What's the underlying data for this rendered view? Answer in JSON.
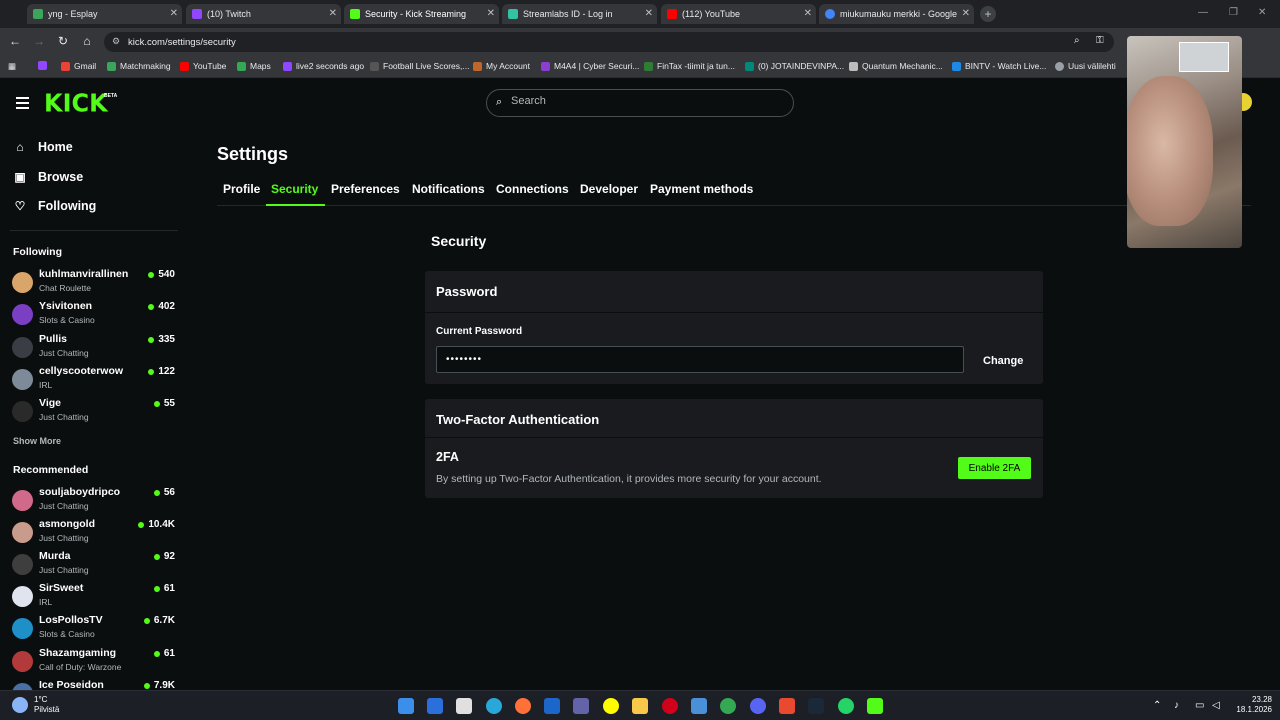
{
  "browser": {
    "tabs": [
      {
        "label": "yng - Esplay",
        "color": "#3ba55c"
      },
      {
        "label": "(10) Twitch",
        "color": "#9146ff"
      },
      {
        "label": "Security - Kick Streaming",
        "color": "#53fc18"
      },
      {
        "label": "Streamlabs ID - Log in",
        "color": "#31c3a2"
      },
      {
        "label": "(112) YouTube",
        "color": "#ff0000"
      },
      {
        "label": "miukumauku merkki - Google",
        "color": "#4285f4"
      }
    ],
    "url": "kick.com/settings/security",
    "bookmarks": [
      {
        "label": "",
        "color": "#9146ff"
      },
      {
        "label": "Gmail",
        "color": "#ea4335"
      },
      {
        "label": "Matchmaking",
        "color": "#3ba55c"
      },
      {
        "label": "YouTube",
        "color": "#ff0000"
      },
      {
        "label": "Maps",
        "color": "#34a853"
      },
      {
        "label": "live2 seconds ago",
        "color": "#9146ff"
      },
      {
        "label": "Football Live Scores,...",
        "color": "#555555"
      },
      {
        "label": "My Account",
        "color": "#c0662a"
      },
      {
        "label": "M4A4 | Cyber Securi...",
        "color": "#8b3fd1"
      },
      {
        "label": "FinTax -tiimit ja tun...",
        "color": "#2e7d32"
      },
      {
        "label": "(0) JOTAINDEVINPA...",
        "color": "#00897b"
      },
      {
        "label": "Quantum Mechanic...",
        "color": "#bdbdbd"
      },
      {
        "label": "BINTV - Watch Live...",
        "color": "#1e88e5"
      },
      {
        "label": "Uusi välilehti",
        "color": "#9aa0a6"
      }
    ]
  },
  "header": {
    "logo": "KICK",
    "beta": "BETA",
    "search_placeholder": "Search"
  },
  "sidebar": {
    "nav": [
      {
        "label": "Home",
        "icon": "home-icon"
      },
      {
        "label": "Browse",
        "icon": "browse-icon"
      },
      {
        "label": "Following",
        "icon": "heart-icon"
      }
    ],
    "following_heading": "Following",
    "following": [
      {
        "name": "kuhlmanvirallinen",
        "category": "Chat Roulette",
        "viewers": "540",
        "color": "#d9a56a"
      },
      {
        "name": "Ysivitonen",
        "category": "Slots & Casino",
        "viewers": "402",
        "color": "#7b3fc4"
      },
      {
        "name": "Pullis",
        "category": "Just Chatting",
        "viewers": "335",
        "color": "#3a3d44"
      },
      {
        "name": "cellyscooterwow",
        "category": "IRL",
        "viewers": "122",
        "color": "#7d8a99"
      },
      {
        "name": "Vige",
        "category": "Just Chatting",
        "viewers": "55",
        "color": "#2a2a2a"
      }
    ],
    "show_more": "Show More",
    "recommended_heading": "Recommended",
    "recommended": [
      {
        "name": "souljaboydripco",
        "category": "Just Chatting",
        "viewers": "56",
        "color": "#d16a8a"
      },
      {
        "name": "asmongold",
        "category": "Just Chatting",
        "viewers": "10.4K",
        "color": "#c89b8c"
      },
      {
        "name": "Murda",
        "category": "Just Chatting",
        "viewers": "92",
        "color": "#3e3e3e"
      },
      {
        "name": "SirSweet",
        "category": "IRL",
        "viewers": "61",
        "color": "#e0e4ef"
      },
      {
        "name": "LosPollosTV",
        "category": "Slots & Casino",
        "viewers": "6.7K",
        "color": "#1f8fc7"
      },
      {
        "name": "Shazamgaming",
        "category": "Call of Duty: Warzone",
        "viewers": "61",
        "color": "#b33a3a"
      },
      {
        "name": "Ice Poseidon",
        "category": "",
        "viewers": "7.9K",
        "color": "#4a6fa5"
      }
    ]
  },
  "settings": {
    "title": "Settings",
    "tabs": [
      "Profile",
      "Security",
      "Preferences",
      "Notifications",
      "Connections",
      "Developer",
      "Payment methods"
    ],
    "active_tab": "Security",
    "section_title": "Security",
    "password_card": {
      "heading": "Password",
      "field_label": "Current Password",
      "field_value": "••••••••",
      "change_label": "Change"
    },
    "twofa_card": {
      "heading": "Two-Factor Authentication",
      "label": "2FA",
      "description": "By setting up Two-Factor Authentication, it provides more security for your account.",
      "button_label": "Enable 2FA"
    }
  },
  "taskbar": {
    "weather_temp": "1°C",
    "weather_desc": "Pilvistä",
    "time": "23.28",
    "date": "18.1.2026"
  },
  "colors": {
    "accent": "#53fc18",
    "background": "#0b0e0f",
    "card": "#191b1f"
  }
}
